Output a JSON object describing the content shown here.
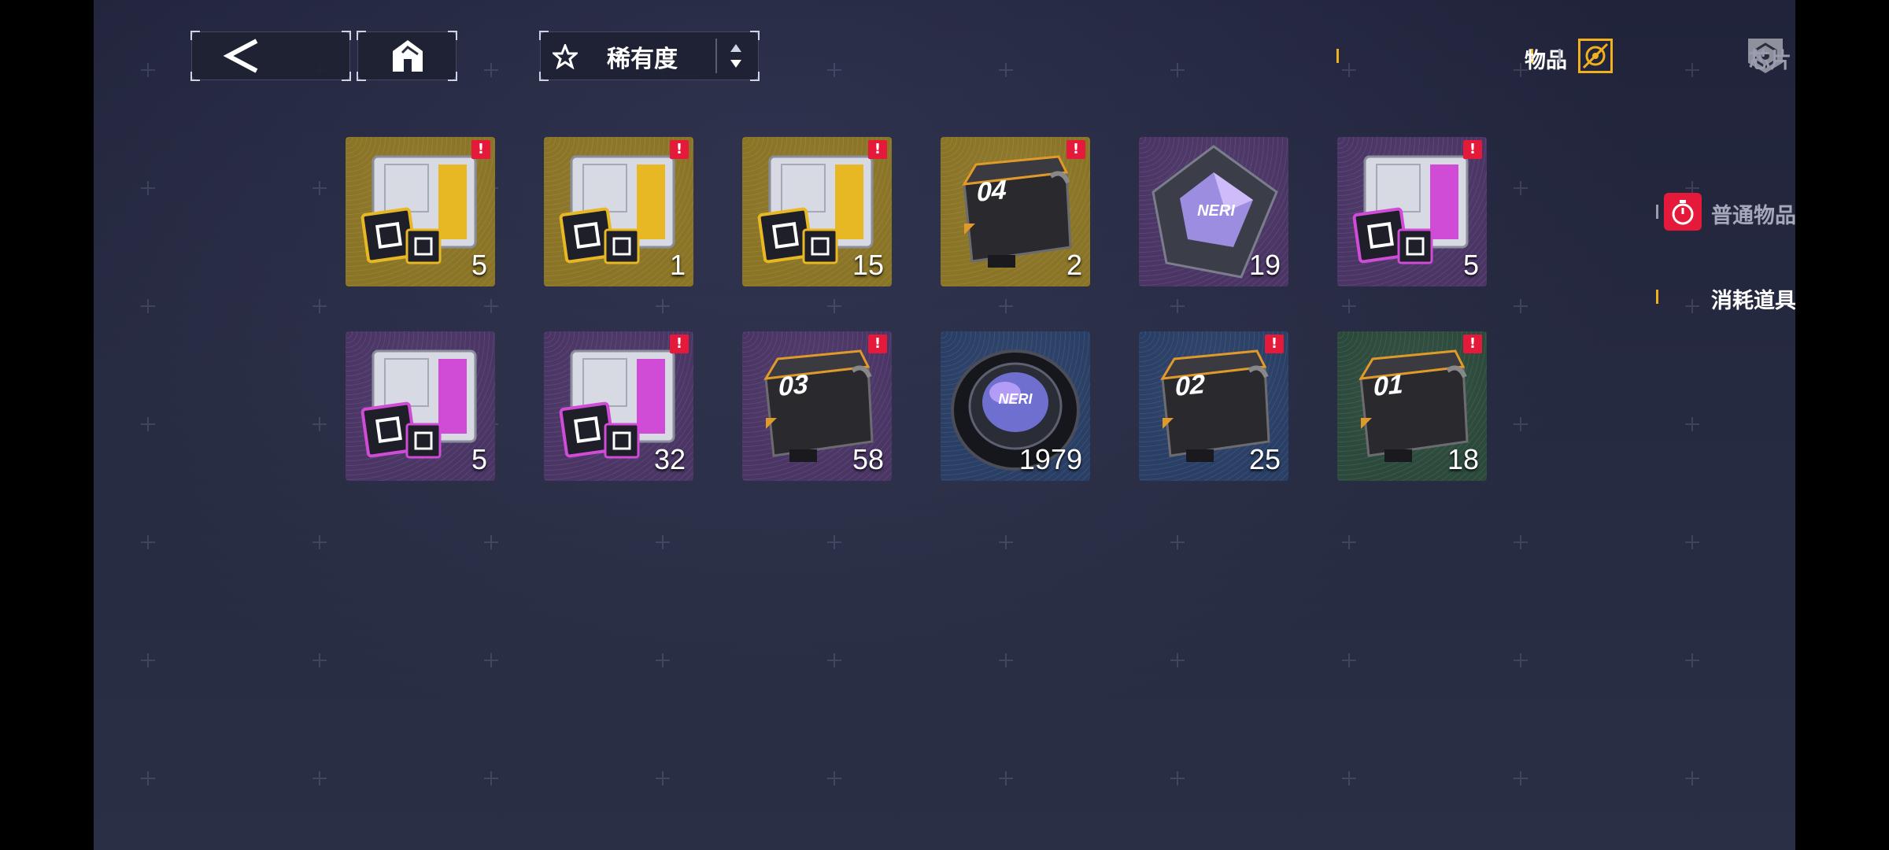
{
  "header": {
    "sort_label": "稀有度",
    "tabs": [
      {
        "label": "物品",
        "active": true
      },
      {
        "label": "芯片",
        "active": false
      }
    ]
  },
  "categories": [
    {
      "label": "普通物品",
      "active": false,
      "alert": ""
    },
    {
      "label": "消耗道具",
      "active": true,
      "alert": "!"
    }
  ],
  "items": [
    {
      "name": "gold chip case",
      "count": "5",
      "alert": "!",
      "rarity": "gold"
    },
    {
      "name": "gold chip case",
      "count": "1",
      "alert": "!",
      "rarity": "gold"
    },
    {
      "name": "gold chip case",
      "count": "15",
      "alert": "!",
      "rarity": "gold"
    },
    {
      "name": "supply crate 04",
      "crate_label": "04",
      "count": "2",
      "alert": "!",
      "rarity": "gold"
    },
    {
      "name": "neri crystal",
      "count": "19",
      "alert": "",
      "rarity": "purple"
    },
    {
      "name": "purple chip case",
      "count": "5",
      "alert": "!",
      "rarity": "purple"
    },
    {
      "name": "purple chip case",
      "count": "5",
      "alert": "",
      "rarity": "purple"
    },
    {
      "name": "purple chip case",
      "count": "32",
      "alert": "!",
      "rarity": "purple"
    },
    {
      "name": "supply crate 03",
      "crate_label": "03",
      "count": "58",
      "alert": "!",
      "rarity": "purple"
    },
    {
      "name": "neri lens",
      "count": "1979",
      "alert": "",
      "rarity": "blue"
    },
    {
      "name": "supply crate 02",
      "crate_label": "02",
      "count": "25",
      "alert": "!",
      "rarity": "blue"
    },
    {
      "name": "supply crate 01",
      "crate_label": "01",
      "count": "18",
      "alert": "!",
      "rarity": "green"
    }
  ],
  "colors": {
    "gold": "#8a7426",
    "purple": "#4a3565",
    "blue": "#2a3f66",
    "green": "#2c4a3c",
    "alert": "#e5193a",
    "accent": "#f2b01e"
  }
}
